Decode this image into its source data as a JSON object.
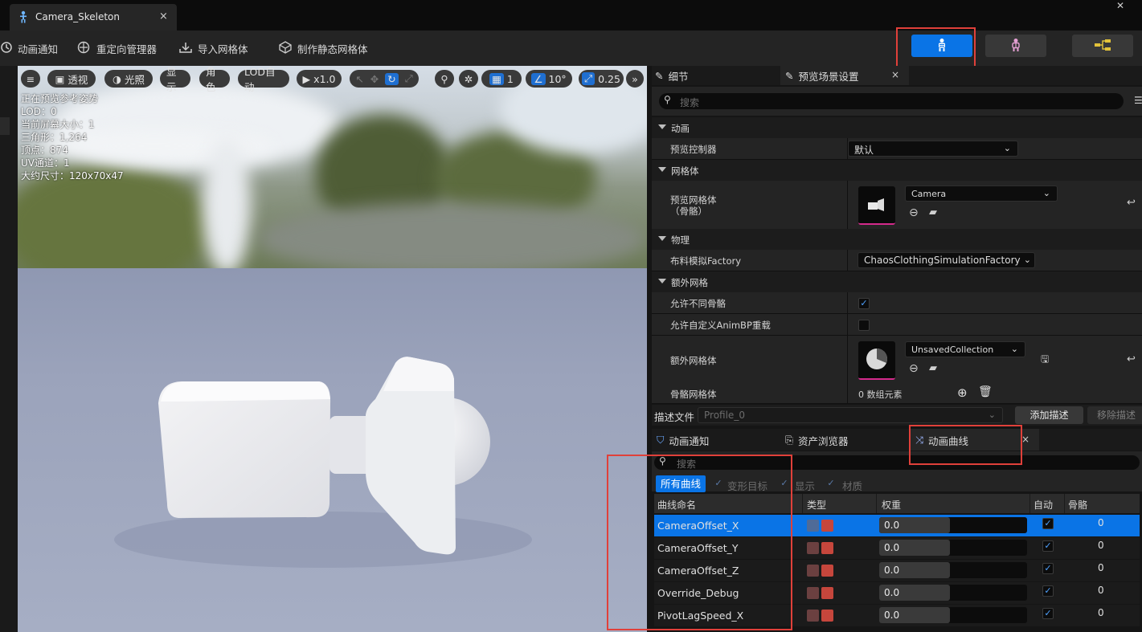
{
  "window": {
    "tab_title": "Camera_Skeleton",
    "close_glyph": "×"
  },
  "toolbar": {
    "items": [
      "动画通知",
      "重定向管理器",
      "导入网格体",
      "制作静态网格体"
    ],
    "mode_buttons": [
      "skeleton-mode",
      "skeletal-mesh-mode",
      "animation-mode"
    ]
  },
  "viewport": {
    "buttons": {
      "menu": "≡",
      "perspective": "透视",
      "lighting": "光照",
      "show": "显示",
      "character": "角色",
      "lod": "LOD自动",
      "playback": "x1.0",
      "grid": "1",
      "angle": "10°",
      "scale": "0.25"
    },
    "stats": [
      "正在预览参考姿势",
      "LOD：0",
      "当前屏幕大小：1",
      "三角形：1,264",
      "顶点：874",
      "UV通道：1",
      "大约尺寸：120x70x47"
    ]
  },
  "details": {
    "tabs": [
      "细节",
      "预览场景设置"
    ],
    "search_placeholder": "搜索",
    "sections": {
      "animation": "动画",
      "preview_controller_label": "预览控制器",
      "preview_controller_value": "默认",
      "mesh": "网格体",
      "preview_mesh_label_1": "预览网格体",
      "preview_mesh_label_2": "（骨骼）",
      "preview_mesh_value": "Camera",
      "physics": "物理",
      "cloth_factory_label": "布料模拟Factory",
      "cloth_factory_value": "ChaosClothingSimulationFactory",
      "extra_mesh": "额外网格",
      "allow_diff_skeleton": "允许不同骨骼",
      "allow_custom_animbp": "允许自定义AnimBP重载",
      "extra_mesh_label": "额外网格体",
      "extra_mesh_value": "UnsavedCollection",
      "skeletal_mesh_label": "骨骼网格体",
      "skeletal_mesh_value": "0 数组元素"
    },
    "profile": {
      "label": "描述文件",
      "value": "Profile_0",
      "add": "添加描述",
      "remove": "移除描述"
    }
  },
  "bottom": {
    "tabs": [
      "动画通知",
      "资产浏览器",
      "动画曲线"
    ],
    "search_placeholder": "搜索",
    "filters": {
      "all": "所有曲线",
      "morph": "变形目标",
      "show": "显示",
      "material": "材质"
    },
    "columns": {
      "name": "曲线命名",
      "type": "类型",
      "weight": "权重",
      "auto": "自动",
      "bone": "骨骼"
    },
    "curves": [
      {
        "name": "CameraOffset_X",
        "weight": "0.0",
        "bone": "0",
        "selected": true
      },
      {
        "name": "CameraOffset_Y",
        "weight": "0.0",
        "bone": "0",
        "selected": false
      },
      {
        "name": "CameraOffset_Z",
        "weight": "0.0",
        "bone": "0",
        "selected": false
      },
      {
        "name": "Override_Debug",
        "weight": "0.0",
        "bone": "0",
        "selected": false
      },
      {
        "name": "PivotLagSpeed_X",
        "weight": "0.0",
        "bone": "0",
        "selected": false
      }
    ]
  },
  "colors": {
    "accent": "#0a74e6",
    "highlight": "#e0403a"
  }
}
